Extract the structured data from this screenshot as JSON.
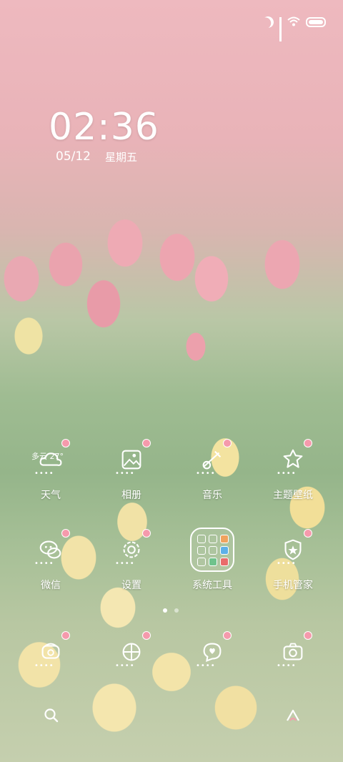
{
  "status_bar": {
    "icons": [
      "moon-icon",
      "signal-icon",
      "wifi-icon",
      "battery-icon"
    ]
  },
  "clock": {
    "time": "02:36",
    "date": "05/12",
    "weekday": "星期五"
  },
  "apps": [
    {
      "label": "天气",
      "icon": "weather-icon",
      "weather_text": "多云 27°"
    },
    {
      "label": "相册",
      "icon": "gallery-icon"
    },
    {
      "label": "音乐",
      "icon": "music-icon"
    },
    {
      "label": "主题壁纸",
      "icon": "theme-icon"
    },
    {
      "label": "微信",
      "icon": "wechat-icon"
    },
    {
      "label": "设置",
      "icon": "settings-icon"
    },
    {
      "label": "系统工具",
      "icon": "folder-icon"
    },
    {
      "label": "手机管家",
      "icon": "security-icon"
    }
  ],
  "dock": [
    {
      "icon": "phone-icon"
    },
    {
      "icon": "browser-icon"
    },
    {
      "icon": "messages-icon"
    },
    {
      "icon": "camera-icon"
    }
  ],
  "pages": {
    "count": 2,
    "active": 1
  },
  "search_bar": {
    "icons": [
      "search-icon",
      "assistant-icon"
    ]
  }
}
